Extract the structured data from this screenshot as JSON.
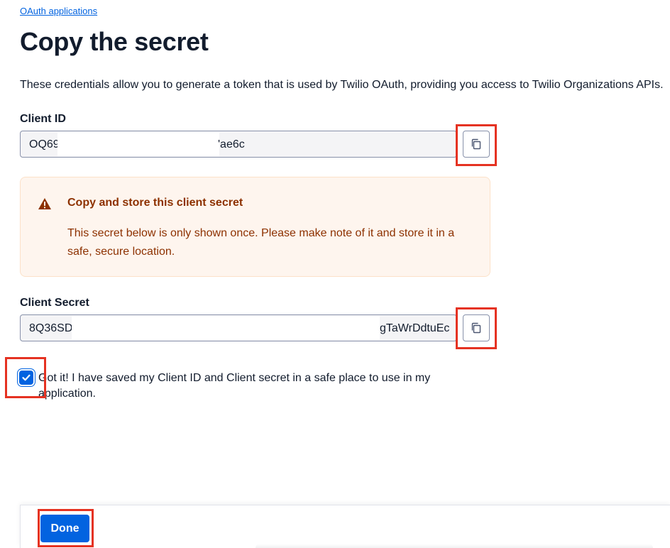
{
  "breadcrumb": {
    "link_label": "OAuth applications"
  },
  "page": {
    "title": "Copy the secret",
    "description": "These credentials allow you to generate a token that is used by Twilio OAuth, providing you access to Twilio Organizations APIs."
  },
  "client_id": {
    "label": "Client ID",
    "value_visible_start": "OQ69",
    "value_visible_end": "'ae6c",
    "copy_icon": "copy-icon"
  },
  "callout": {
    "icon": "warning-icon",
    "title": "Copy and store this client secret",
    "body": "This secret below is only shown once. Please make note of it and store it in a safe, secure location."
  },
  "client_secret": {
    "label": "Client Secret",
    "value_visible_start": "8Q36SD",
    "value_visible_end": "gTaWrDdtuEc",
    "copy_icon": "copy-icon"
  },
  "confirmation": {
    "checked": true,
    "label": "Got it! I have saved my Client ID and Client secret in a safe place to use in my application."
  },
  "footer": {
    "done_label": "Done"
  },
  "colors": {
    "accent": "#0263e0",
    "highlight": "#e53222",
    "warning_text": "#8d3100",
    "warning_bg": "#fef5ee"
  }
}
